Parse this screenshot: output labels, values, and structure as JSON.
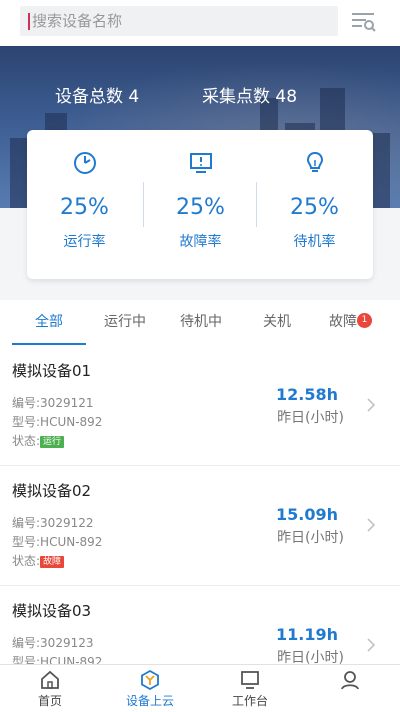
{
  "search": {
    "placeholder": "搜索设备名称"
  },
  "hero": {
    "device_total_label": "设备总数",
    "device_total": "4",
    "points_label": "采集点数",
    "points": "48"
  },
  "metrics": [
    {
      "value": "25%",
      "label": "运行率",
      "icon": "speed-gauge-icon"
    },
    {
      "value": "25%",
      "label": "故障率",
      "icon": "monitor-alert-icon"
    },
    {
      "value": "25%",
      "label": "待机率",
      "icon": "lightbulb-icon"
    }
  ],
  "tabs": [
    {
      "label": "全部",
      "active": true
    },
    {
      "label": "运行中"
    },
    {
      "label": "待机中"
    },
    {
      "label": "关机"
    },
    {
      "label": "故障",
      "badge": "1"
    }
  ],
  "devices": [
    {
      "name": "模拟设备01",
      "number": "编号:3029121",
      "model": "型号:HCUN-892",
      "status_label": "状态:",
      "status": "运行",
      "status_color": "#4caf50",
      "hours": "12.58h",
      "hours_label": "昨日(小时)"
    },
    {
      "name": "模拟设备02",
      "number": "编号:3029122",
      "model": "型号:HCUN-892",
      "status_label": "状态:",
      "status": "故障",
      "status_color": "#e8473a",
      "hours": "15.09h",
      "hours_label": "昨日(小时)"
    },
    {
      "name": "模拟设备03",
      "number": "编号:3029123",
      "model": "型号:HCUN-892",
      "status_label": "状态:",
      "status": "",
      "status_color": "",
      "hours": "11.19h",
      "hours_label": "昨日(小时)"
    }
  ],
  "nav": [
    {
      "label": "首页",
      "icon": "home-icon"
    },
    {
      "label": "设备上云",
      "icon": "cloud-device-icon",
      "active": true
    },
    {
      "label": "工作台",
      "icon": "monitor-icon"
    },
    {
      "label": "",
      "icon": "user-icon"
    }
  ],
  "colors": {
    "accent": "#1f7ad0",
    "running": "#4caf50",
    "fault": "#e8473a"
  }
}
